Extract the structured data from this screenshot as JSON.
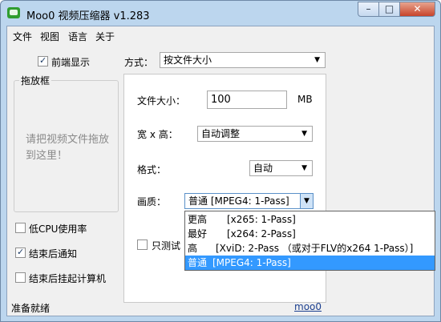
{
  "window": {
    "title": "Moo0 视频压缩器 v1.283"
  },
  "menu": {
    "file": "文件",
    "view": "视图",
    "language": "语言",
    "about": "关于"
  },
  "left": {
    "front_display": "前端显示",
    "drop_box_title": "拖放框",
    "drop_hint": "请把视频文件拖放到这里！",
    "low_cpu": "低CPU使用率",
    "notify_done": "结束后通知",
    "hibernate_done": "结束后挂起计算机"
  },
  "right": {
    "method_label": "方式：",
    "method_value": "按文件大小",
    "filesize_label": "文件大小：",
    "filesize_value": "100",
    "filesize_unit": "MB",
    "dims_label": "宽 x 高：",
    "dims_value": "自动调整",
    "format_label": "格式：",
    "format_value": "自动",
    "quality_label": "画质：",
    "quality_value": "普通  [MPEG4: 1-Pass]",
    "test_label": "只测试"
  },
  "quality_options": [
    {
      "name": "更高",
      "desc": "[x265: 1-Pass]"
    },
    {
      "name": "最好",
      "desc": "[x264: 2-Pass]"
    },
    {
      "name": "高",
      "desc": "[XviD: 2-Pass （或对于FLV的x264 1-Pass）]"
    },
    {
      "name": "普通",
      "desc": "[MPEG4: 1-Pass]"
    }
  ],
  "status": {
    "text": "准备就绪",
    "link": "moo0"
  },
  "state": {
    "front_display_checked": true,
    "low_cpu_checked": false,
    "notify_checked": true,
    "hibernate_checked": false,
    "test_checked": false,
    "selected_quality": 3
  }
}
